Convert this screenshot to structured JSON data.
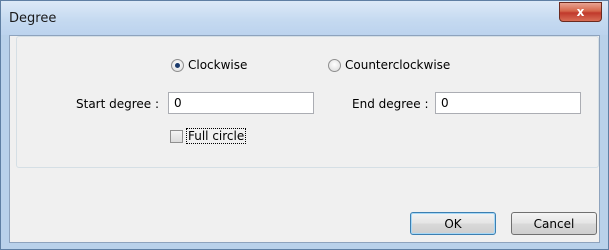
{
  "window": {
    "title": "Degree",
    "close_label": "x"
  },
  "direction": {
    "options": [
      {
        "label": "Clockwise",
        "checked": true
      },
      {
        "label": "Counterclockwise",
        "checked": false
      }
    ]
  },
  "start_degree": {
    "label": "Start degree :",
    "value": "0"
  },
  "end_degree": {
    "label": "End degree :",
    "value": "0"
  },
  "full_circle": {
    "label": "Full circle",
    "checked": false
  },
  "buttons": {
    "ok": "OK",
    "cancel": "Cancel"
  }
}
